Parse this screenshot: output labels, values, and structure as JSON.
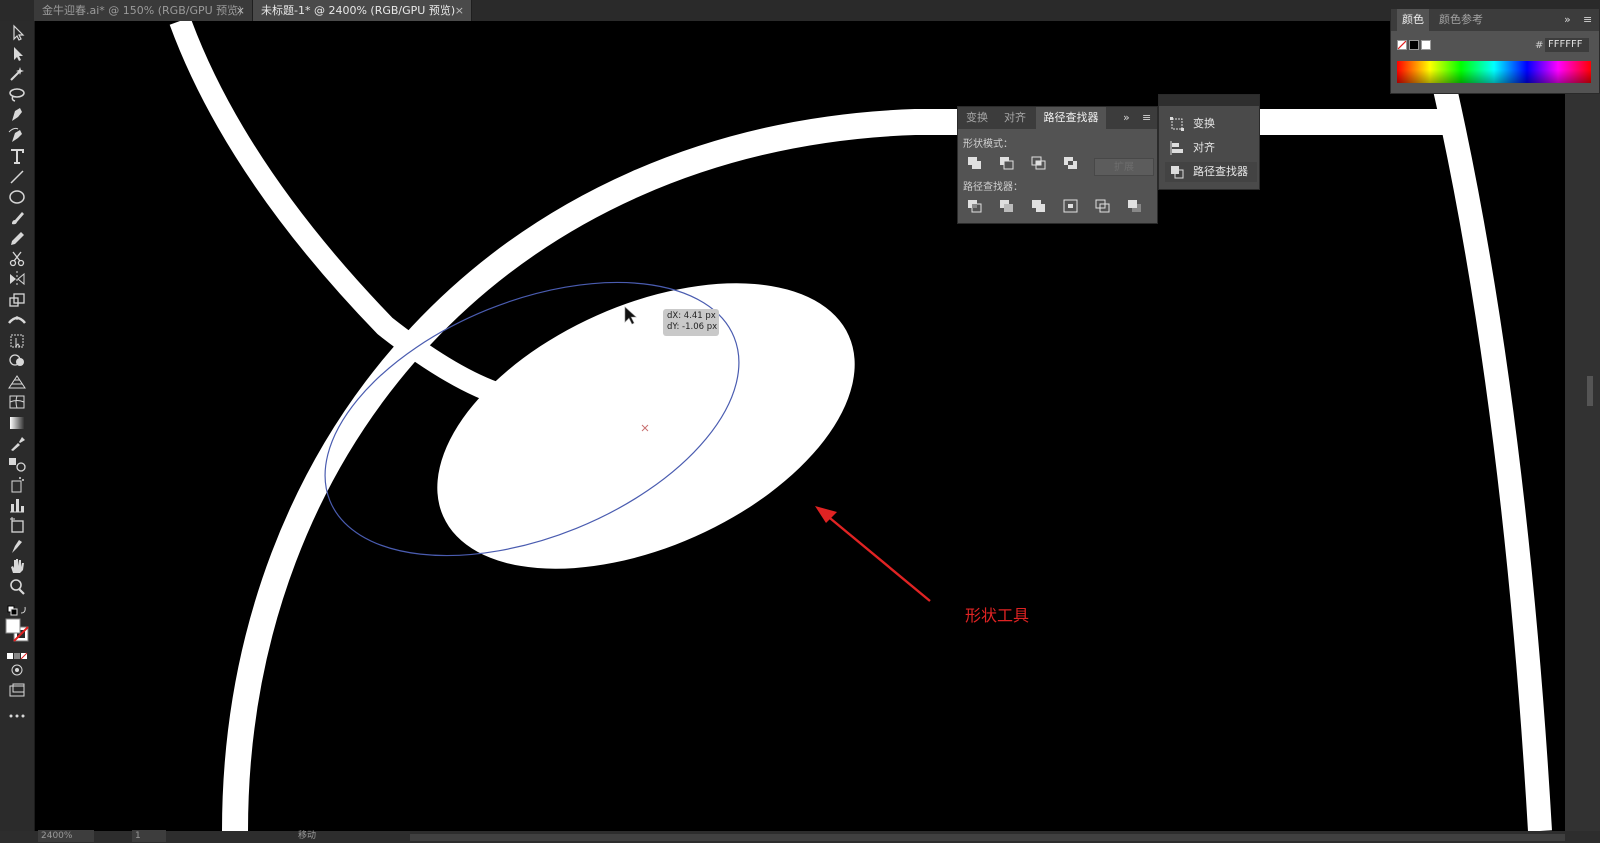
{
  "tabs": [
    {
      "title": "金牛迎春.ai* @ 150% (RGB/GPU 预览)",
      "close": "×"
    },
    {
      "title": "未标题-1* @ 2400% (RGB/GPU 预览)",
      "close": "×"
    }
  ],
  "tools": [
    "selection",
    "direct-selection",
    "magic-wand",
    "lasso",
    "pen",
    "curvature",
    "type",
    "line-segment",
    "ellipse",
    "paintbrush",
    "pencil",
    "scissors",
    "rotate",
    "scale",
    "width",
    "free-transform",
    "shape-builder",
    "perspective-grid",
    "mesh",
    "gradient",
    "eyedropper",
    "blend",
    "symbol-sprayer",
    "column-graph",
    "artboard",
    "slice",
    "hand",
    "zoom"
  ],
  "canvas": {
    "tooltip": {
      "dx": "dX: 4.41 px",
      "dy": "dY: -1.06 px"
    },
    "annotation": "形状工具",
    "annotation_color": "#e02323",
    "selection_color": "#4a5cb0"
  },
  "pathfinder_panel": {
    "tabs": [
      "变换",
      "对齐",
      "路径查找器"
    ],
    "active_tab": "路径查找器",
    "shape_modes_label": "形状模式：",
    "pathfinders_label": "路径查找器：",
    "expand_label": "扩展",
    "overflow": "»",
    "menu": "≡"
  },
  "mini_panel": {
    "items": [
      "变换",
      "对齐",
      "路径查找器"
    ],
    "selected": "路径查找器"
  },
  "color_panel": {
    "tabs": [
      "颜色",
      "颜色参考"
    ],
    "active_tab": "颜色",
    "hex_prefix": "#",
    "hex_value": "FFFFFF",
    "overflow": "»",
    "menu": "≡"
  },
  "status": {
    "zoom": "2400%",
    "page": "1",
    "mode": "移动"
  }
}
